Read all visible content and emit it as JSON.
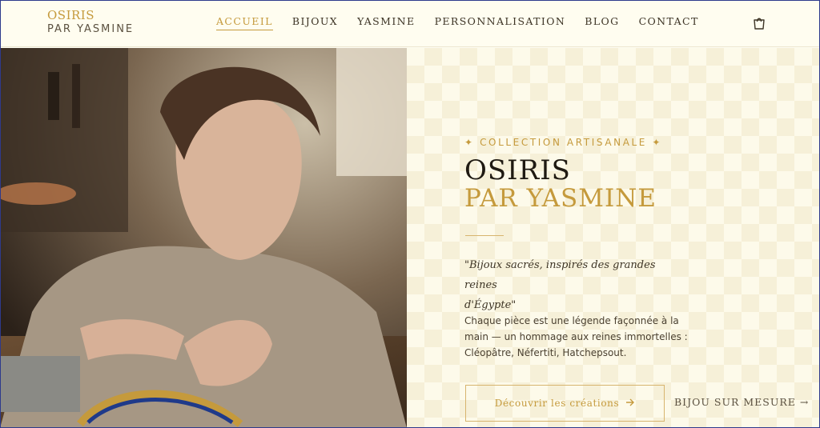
{
  "brand": {
    "name_line1": "OSIRIS",
    "name_line2": "PAR YASMINE"
  },
  "nav": {
    "items": [
      {
        "label": "ACCUEIL",
        "active": true
      },
      {
        "label": "BIJOUX"
      },
      {
        "label": "YASMINE"
      },
      {
        "label": "PERSONNALISATION"
      },
      {
        "label": "BLOG"
      },
      {
        "label": "CONTACT"
      }
    ],
    "cart_icon": "shopping-bag-icon"
  },
  "hero": {
    "tagline": "✦ COLLECTION ARTISANALE ✦",
    "title_line1": "OSIRIS",
    "title_line2": "PAR YASMINE",
    "quote_line1": "\"Bijoux sacrés, inspirés des grandes reines",
    "quote_line2": "d'Égypte\"",
    "description": "Chaque pièce est une légende façonnée à la main — un hommage aux reines immortelles : Cléopâtre, Néfertiti, Hatchepsout.",
    "primary_cta": "Découvrir les créations",
    "secondary_cta": "BIJOU SUR MESURE →"
  },
  "colors": {
    "accent": "#c59a3c",
    "background": "#fefdf3",
    "text": "#2b2418"
  }
}
